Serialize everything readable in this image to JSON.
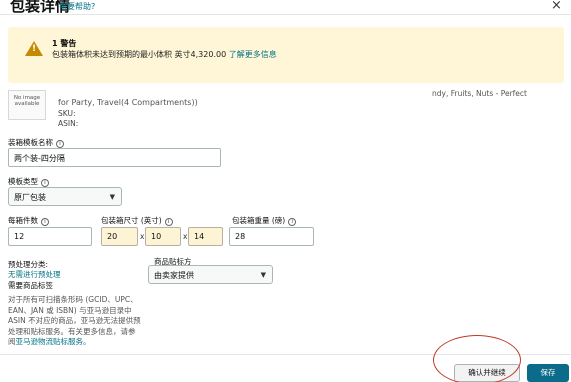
{
  "header": {
    "title": "包装详情",
    "help_link": "需要帮助?",
    "close_icon": "×"
  },
  "warning": {
    "title": "1 警告",
    "text": "包装箱体积未达到预期的最小体积 英寸4,320.00",
    "link": "了解更多信息",
    "icon": "warning-triangle-icon",
    "background_color": "#fef6d6"
  },
  "product": {
    "image_placeholder": "No image available",
    "name_fragment": "for Party, Travel(4 Compartments))",
    "name_fragment_right": "ndy, Fruits, Nuts - Perfect",
    "sku_label": "SKU:",
    "asin_label": "ASIN:"
  },
  "form": {
    "template_name": {
      "label": "装箱模板名称",
      "value": "两个装-四分隔"
    },
    "template_type": {
      "label": "模板类型",
      "value": "原厂包装"
    },
    "units_per_box": {
      "label": "每箱件数",
      "value": "12"
    },
    "box_dimensions": {
      "label": "包装箱尺寸 (英寸)",
      "length": "20",
      "width": "10",
      "height": "14",
      "times": "x"
    },
    "box_weight": {
      "label": "包装箱重量 (磅)",
      "value": "28"
    },
    "prep": {
      "label": "预处理分类:",
      "value": "无需进行预处理",
      "required_label": "需要商品标签"
    },
    "labeling": {
      "label": "商品贴标方",
      "value": "由卖家提供"
    },
    "help_text": "对于所有可扫描条形码 (GCID、UPC、EAN、JAN 或 ISBN) 与亚马逊目录中 ASIN 不对应的商品，亚马逊无法提供预处理和贴标服务。有关更多信息，请参阅",
    "help_link": "亚马逊物流贴标服务。"
  },
  "footer": {
    "confirm_label": "确认并继续",
    "save_label": "保存",
    "accent_color": "#0b6b8a",
    "annotation_color": "#c0392b"
  }
}
